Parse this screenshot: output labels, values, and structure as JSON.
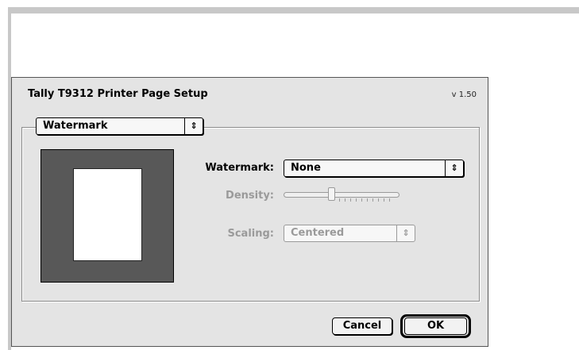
{
  "dialog": {
    "title": "Tally T9312 Printer Page Setup",
    "version": "v 1.50"
  },
  "section_popup": {
    "selected": "Watermark",
    "arrow_icon": "up-down-arrow-icon"
  },
  "fields": {
    "watermark": {
      "label": "Watermark:",
      "value": "None",
      "enabled": true
    },
    "density": {
      "label": "Density:",
      "enabled": false
    },
    "scaling": {
      "label": "Scaling:",
      "value": "Centered",
      "enabled": false
    }
  },
  "buttons": {
    "cancel": "Cancel",
    "ok": "OK"
  },
  "colors": {
    "dialog_background": "#e4e4e4",
    "preview_background": "#585858",
    "disabled_text": "#9a9a9a"
  },
  "arrow_glyph": "⇕"
}
